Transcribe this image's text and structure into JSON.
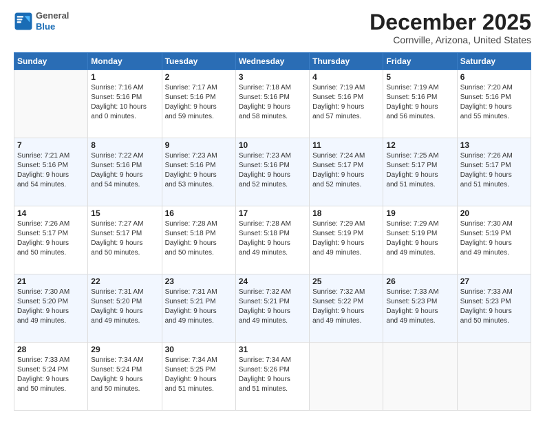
{
  "header": {
    "logo_general": "General",
    "logo_blue": "Blue",
    "month_title": "December 2025",
    "location": "Cornville, Arizona, United States"
  },
  "days_of_week": [
    "Sunday",
    "Monday",
    "Tuesday",
    "Wednesday",
    "Thursday",
    "Friday",
    "Saturday"
  ],
  "weeks": [
    [
      {
        "day": "",
        "empty": true,
        "lines": []
      },
      {
        "day": "1",
        "empty": false,
        "lines": [
          "Sunrise: 7:16 AM",
          "Sunset: 5:16 PM",
          "Daylight: 10 hours",
          "and 0 minutes."
        ]
      },
      {
        "day": "2",
        "empty": false,
        "lines": [
          "Sunrise: 7:17 AM",
          "Sunset: 5:16 PM",
          "Daylight: 9 hours",
          "and 59 minutes."
        ]
      },
      {
        "day": "3",
        "empty": false,
        "lines": [
          "Sunrise: 7:18 AM",
          "Sunset: 5:16 PM",
          "Daylight: 9 hours",
          "and 58 minutes."
        ]
      },
      {
        "day": "4",
        "empty": false,
        "lines": [
          "Sunrise: 7:19 AM",
          "Sunset: 5:16 PM",
          "Daylight: 9 hours",
          "and 57 minutes."
        ]
      },
      {
        "day": "5",
        "empty": false,
        "lines": [
          "Sunrise: 7:19 AM",
          "Sunset: 5:16 PM",
          "Daylight: 9 hours",
          "and 56 minutes."
        ]
      },
      {
        "day": "6",
        "empty": false,
        "lines": [
          "Sunrise: 7:20 AM",
          "Sunset: 5:16 PM",
          "Daylight: 9 hours",
          "and 55 minutes."
        ]
      }
    ],
    [
      {
        "day": "7",
        "empty": false,
        "lines": [
          "Sunrise: 7:21 AM",
          "Sunset: 5:16 PM",
          "Daylight: 9 hours",
          "and 54 minutes."
        ]
      },
      {
        "day": "8",
        "empty": false,
        "lines": [
          "Sunrise: 7:22 AM",
          "Sunset: 5:16 PM",
          "Daylight: 9 hours",
          "and 54 minutes."
        ]
      },
      {
        "day": "9",
        "empty": false,
        "lines": [
          "Sunrise: 7:23 AM",
          "Sunset: 5:16 PM",
          "Daylight: 9 hours",
          "and 53 minutes."
        ]
      },
      {
        "day": "10",
        "empty": false,
        "lines": [
          "Sunrise: 7:23 AM",
          "Sunset: 5:16 PM",
          "Daylight: 9 hours",
          "and 52 minutes."
        ]
      },
      {
        "day": "11",
        "empty": false,
        "lines": [
          "Sunrise: 7:24 AM",
          "Sunset: 5:17 PM",
          "Daylight: 9 hours",
          "and 52 minutes."
        ]
      },
      {
        "day": "12",
        "empty": false,
        "lines": [
          "Sunrise: 7:25 AM",
          "Sunset: 5:17 PM",
          "Daylight: 9 hours",
          "and 51 minutes."
        ]
      },
      {
        "day": "13",
        "empty": false,
        "lines": [
          "Sunrise: 7:26 AM",
          "Sunset: 5:17 PM",
          "Daylight: 9 hours",
          "and 51 minutes."
        ]
      }
    ],
    [
      {
        "day": "14",
        "empty": false,
        "lines": [
          "Sunrise: 7:26 AM",
          "Sunset: 5:17 PM",
          "Daylight: 9 hours",
          "and 50 minutes."
        ]
      },
      {
        "day": "15",
        "empty": false,
        "lines": [
          "Sunrise: 7:27 AM",
          "Sunset: 5:17 PM",
          "Daylight: 9 hours",
          "and 50 minutes."
        ]
      },
      {
        "day": "16",
        "empty": false,
        "lines": [
          "Sunrise: 7:28 AM",
          "Sunset: 5:18 PM",
          "Daylight: 9 hours",
          "and 50 minutes."
        ]
      },
      {
        "day": "17",
        "empty": false,
        "lines": [
          "Sunrise: 7:28 AM",
          "Sunset: 5:18 PM",
          "Daylight: 9 hours",
          "and 49 minutes."
        ]
      },
      {
        "day": "18",
        "empty": false,
        "lines": [
          "Sunrise: 7:29 AM",
          "Sunset: 5:19 PM",
          "Daylight: 9 hours",
          "and 49 minutes."
        ]
      },
      {
        "day": "19",
        "empty": false,
        "lines": [
          "Sunrise: 7:29 AM",
          "Sunset: 5:19 PM",
          "Daylight: 9 hours",
          "and 49 minutes."
        ]
      },
      {
        "day": "20",
        "empty": false,
        "lines": [
          "Sunrise: 7:30 AM",
          "Sunset: 5:19 PM",
          "Daylight: 9 hours",
          "and 49 minutes."
        ]
      }
    ],
    [
      {
        "day": "21",
        "empty": false,
        "lines": [
          "Sunrise: 7:30 AM",
          "Sunset: 5:20 PM",
          "Daylight: 9 hours",
          "and 49 minutes."
        ]
      },
      {
        "day": "22",
        "empty": false,
        "lines": [
          "Sunrise: 7:31 AM",
          "Sunset: 5:20 PM",
          "Daylight: 9 hours",
          "and 49 minutes."
        ]
      },
      {
        "day": "23",
        "empty": false,
        "lines": [
          "Sunrise: 7:31 AM",
          "Sunset: 5:21 PM",
          "Daylight: 9 hours",
          "and 49 minutes."
        ]
      },
      {
        "day": "24",
        "empty": false,
        "lines": [
          "Sunrise: 7:32 AM",
          "Sunset: 5:21 PM",
          "Daylight: 9 hours",
          "and 49 minutes."
        ]
      },
      {
        "day": "25",
        "empty": false,
        "lines": [
          "Sunrise: 7:32 AM",
          "Sunset: 5:22 PM",
          "Daylight: 9 hours",
          "and 49 minutes."
        ]
      },
      {
        "day": "26",
        "empty": false,
        "lines": [
          "Sunrise: 7:33 AM",
          "Sunset: 5:23 PM",
          "Daylight: 9 hours",
          "and 49 minutes."
        ]
      },
      {
        "day": "27",
        "empty": false,
        "lines": [
          "Sunrise: 7:33 AM",
          "Sunset: 5:23 PM",
          "Daylight: 9 hours",
          "and 50 minutes."
        ]
      }
    ],
    [
      {
        "day": "28",
        "empty": false,
        "lines": [
          "Sunrise: 7:33 AM",
          "Sunset: 5:24 PM",
          "Daylight: 9 hours",
          "and 50 minutes."
        ]
      },
      {
        "day": "29",
        "empty": false,
        "lines": [
          "Sunrise: 7:34 AM",
          "Sunset: 5:24 PM",
          "Daylight: 9 hours",
          "and 50 minutes."
        ]
      },
      {
        "day": "30",
        "empty": false,
        "lines": [
          "Sunrise: 7:34 AM",
          "Sunset: 5:25 PM",
          "Daylight: 9 hours",
          "and 51 minutes."
        ]
      },
      {
        "day": "31",
        "empty": false,
        "lines": [
          "Sunrise: 7:34 AM",
          "Sunset: 5:26 PM",
          "Daylight: 9 hours",
          "and 51 minutes."
        ]
      },
      {
        "day": "",
        "empty": true,
        "lines": []
      },
      {
        "day": "",
        "empty": true,
        "lines": []
      },
      {
        "day": "",
        "empty": true,
        "lines": []
      }
    ]
  ]
}
